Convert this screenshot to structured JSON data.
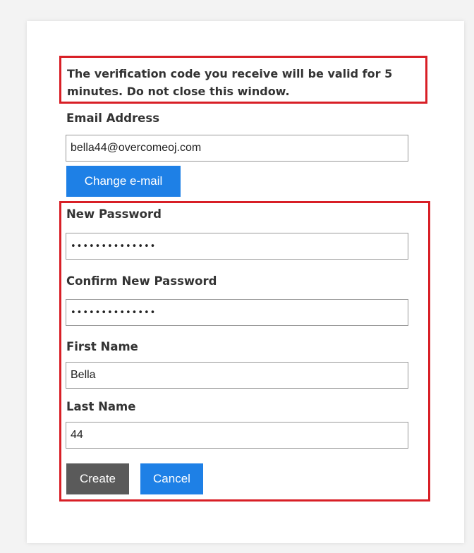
{
  "notice": {
    "text": "The verification code you receive will be valid for 5 minutes. Do not close this window."
  },
  "email": {
    "label": "Email Address",
    "value": "bella44@overcomeoj.com",
    "change_button": "Change e-mail"
  },
  "new_password": {
    "label": "New Password",
    "value": "••••••••••••••"
  },
  "confirm_password": {
    "label": "Confirm New Password",
    "value": "••••••••••••••"
  },
  "first_name": {
    "label": "First Name",
    "value": "Bella"
  },
  "last_name": {
    "label": "Last Name",
    "value": "44"
  },
  "actions": {
    "create": "Create",
    "cancel": "Cancel"
  },
  "colors": {
    "highlight_border": "#d81f26",
    "primary_button": "#1e80e6",
    "secondary_button": "#5a5a5a"
  }
}
